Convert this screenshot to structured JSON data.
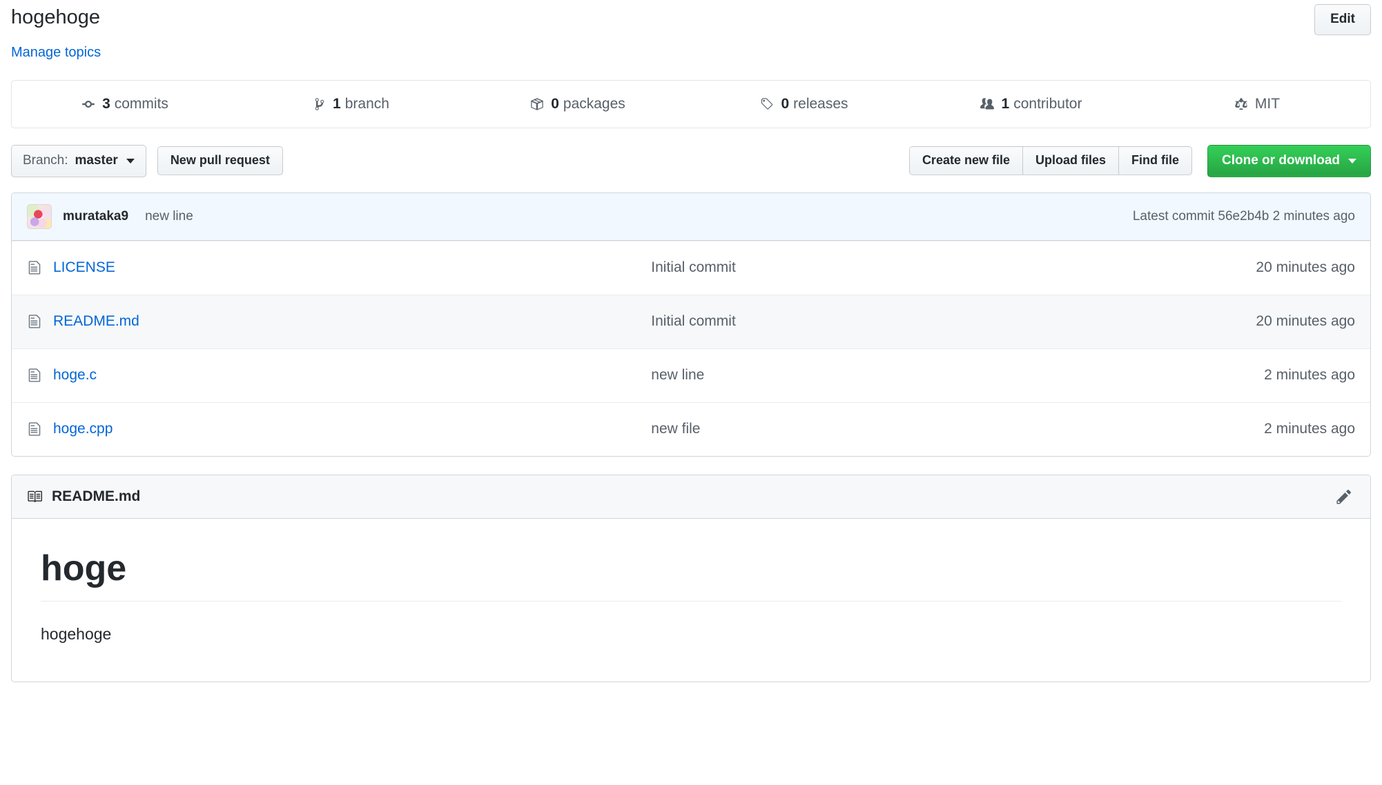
{
  "repo": {
    "name": "hogehoge",
    "manage_topics_label": "Manage topics",
    "edit_button_label": "Edit"
  },
  "stats": [
    {
      "icon": "commit-icon",
      "count": "3",
      "label": "commits"
    },
    {
      "icon": "branch-icon",
      "count": "1",
      "label": "branch"
    },
    {
      "icon": "package-icon",
      "count": "0",
      "label": "packages"
    },
    {
      "icon": "tag-icon",
      "count": "0",
      "label": "releases"
    },
    {
      "icon": "people-icon",
      "count": "1",
      "label": "contributor"
    },
    {
      "icon": "law-icon",
      "count": "",
      "label": "MIT"
    }
  ],
  "toolbar": {
    "branch_prefix": "Branch:",
    "branch_name": "master",
    "new_pull_request_label": "New pull request",
    "create_new_file_label": "Create new file",
    "upload_files_label": "Upload files",
    "find_file_label": "Find file",
    "clone_or_download_label": "Clone or download"
  },
  "latest_commit": {
    "author": "murataka9",
    "message": "new line",
    "meta_prefix": "Latest commit",
    "sha": "56e2b4b",
    "age": "2 minutes ago"
  },
  "files": [
    {
      "icon": "file-icon",
      "name": "LICENSE",
      "message": "Initial commit",
      "age": "20 minutes ago"
    },
    {
      "icon": "file-icon",
      "name": "README.md",
      "message": "Initial commit",
      "age": "20 minutes ago"
    },
    {
      "icon": "file-icon",
      "name": "hoge.c",
      "message": "new line",
      "age": "2 minutes ago"
    },
    {
      "icon": "file-icon",
      "name": "hoge.cpp",
      "message": "new file",
      "age": "2 minutes ago"
    }
  ],
  "readme": {
    "icon": "book-icon",
    "filename": "README.md",
    "edit_icon": "pencil-icon",
    "heading": "hoge",
    "paragraph": "hogehoge"
  },
  "colors": {
    "link": "#0366d6",
    "text": "#24292e",
    "muted": "#586069",
    "green_button": "#28a745",
    "commit_bar_bg": "#f1f8ff",
    "border": "#d1d5da"
  }
}
